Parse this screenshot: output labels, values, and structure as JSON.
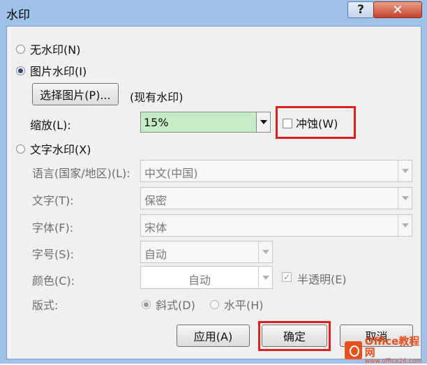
{
  "window": {
    "title": "水印",
    "help_label": "?",
    "close_label": "✕"
  },
  "options": {
    "no_watermark": "无水印(N)",
    "picture_watermark": "图片水印(I)",
    "text_watermark": "文字水印(X)",
    "selected": "picture_watermark"
  },
  "picture": {
    "select_button": "选择图片(P)...",
    "status": "(现有水印)",
    "scale_label": "缩放(L):",
    "scale_value": "15%",
    "washout_label": "冲蚀(W)",
    "washout_checked": false
  },
  "text": {
    "language_label": "语言(国家/地区)(L):",
    "language_value": "中文(中国)",
    "text_label": "文字(T):",
    "text_value": "保密",
    "font_label": "字体(F):",
    "font_value": "宋体",
    "size_label": "字号(S):",
    "size_value": "自动",
    "color_label": "颜色(C):",
    "color_value": "自动",
    "semitransparent_label": "半透明(E)",
    "semitransparent_checked": true,
    "layout_label": "版式:",
    "layout_diagonal": "斜式(D)",
    "layout_horizontal": "水平(H)",
    "layout_selected": "diagonal"
  },
  "buttons": {
    "apply": "应用(A)",
    "ok": "确定",
    "cancel": "取消"
  },
  "watermark_logo": {
    "main": "Office教程网",
    "url": "www.office26.com"
  },
  "colors": {
    "highlight_red": "#e02020",
    "scale_field_bg": "#c6ebc7",
    "title_bar": "#9fc3e8",
    "logo_orange": "#e8501e"
  }
}
